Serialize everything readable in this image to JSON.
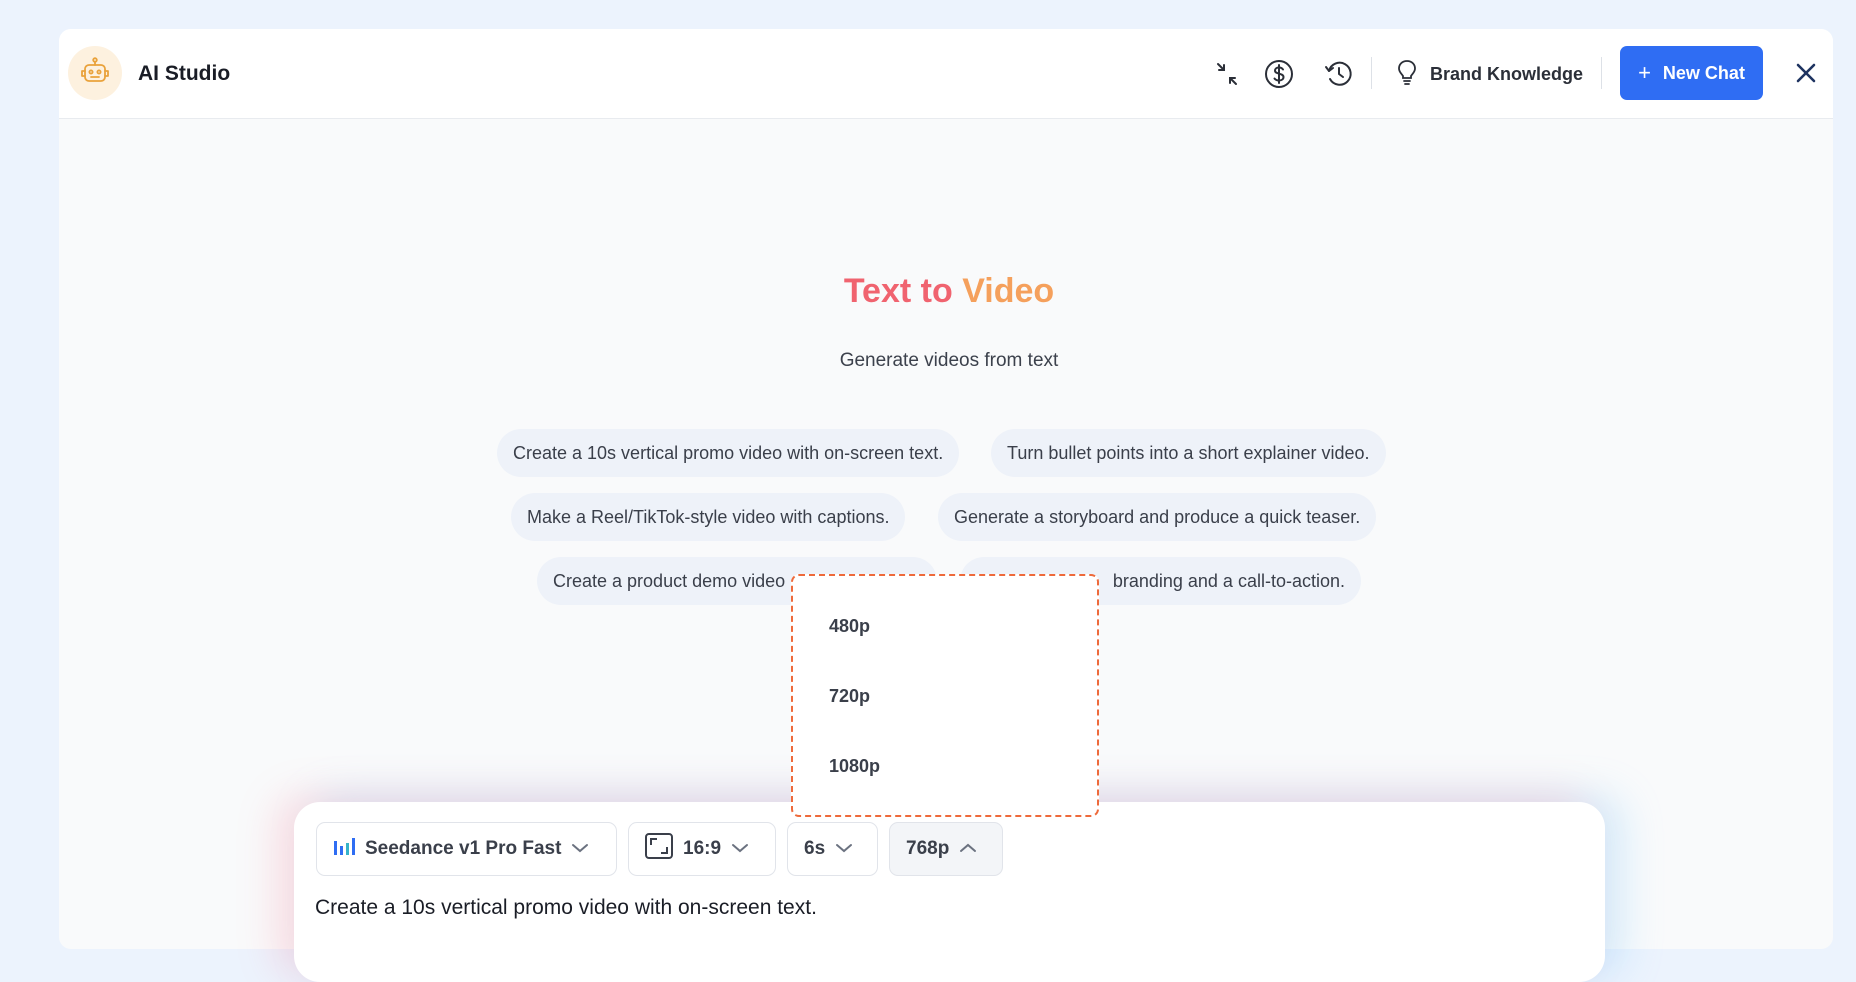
{
  "app": {
    "title": "AI Studio"
  },
  "header": {
    "icons": [
      "collapse-icon",
      "dollar-icon",
      "history-icon",
      "lightbulb-icon",
      "close-icon"
    ],
    "brand_knowledge_label": "Brand Knowledge",
    "new_chat_label": "New Chat",
    "new_chat_plus": "+"
  },
  "hero": {
    "title_part1": "Text to",
    "title_part2": "Video",
    "subtitle": "Generate videos from text"
  },
  "suggestions": [
    "Create a 10s vertical promo video with on-screen text.",
    "Turn bullet points into a short explainer video.",
    "Make a Reel/TikTok-style video with captions.",
    "Generate a storyboard and produce a quick teaser.",
    "Create a product demo video",
    "branding and a call-to-action."
  ],
  "composer": {
    "model_label": "Seedance v1 Pro Fast",
    "aspect_label": "16:9",
    "duration_label": "6s",
    "resolution_label": "768p",
    "prompt_text": "Create a 10s vertical promo video with on-screen text."
  },
  "resolution_dropdown": {
    "options": [
      "480p",
      "720p",
      "1080p"
    ]
  },
  "colors": {
    "accent": "#2f6df3",
    "title_pink": "#f0636f",
    "title_orange": "#f5a05c",
    "dropdown_border": "#ee6a3b"
  }
}
